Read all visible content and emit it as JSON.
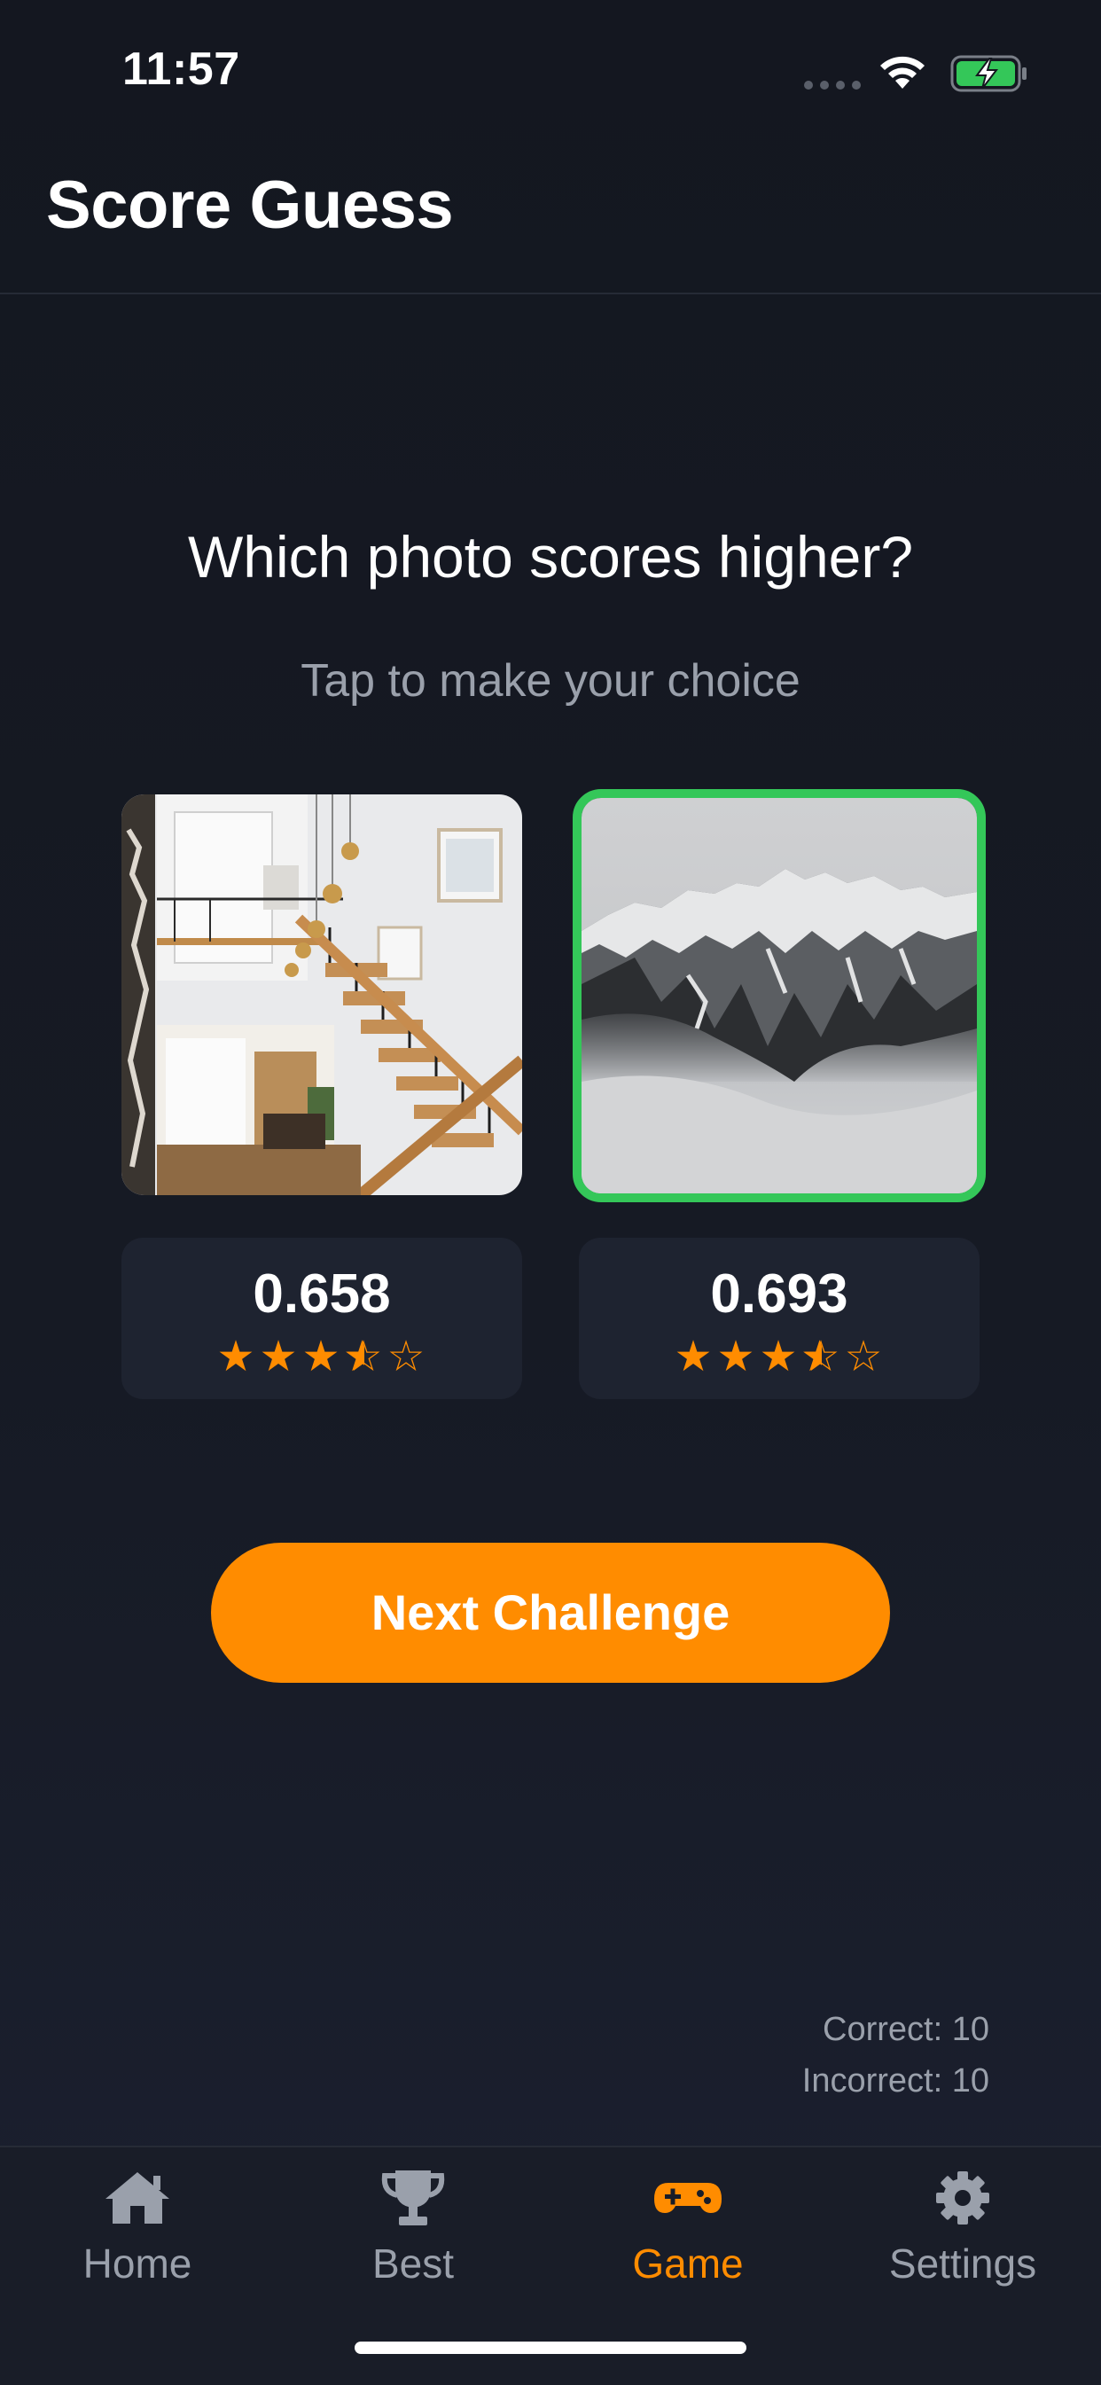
{
  "status_bar": {
    "time": "11:57",
    "icons": [
      "signal-dots-icon",
      "wifi-icon",
      "battery-charging-icon"
    ]
  },
  "nav": {
    "title": "Score Guess"
  },
  "prompt": {
    "question": "Which photo scores higher?",
    "subtitle": "Tap to make your choice"
  },
  "photos": [
    {
      "subject": "interior staircase with pendant lamps",
      "selected": false,
      "score": "0.658",
      "stars": 3.5,
      "max_stars": 5
    },
    {
      "subject": "snowy mountain peaks above clouds",
      "selected": true,
      "score": "0.693",
      "stars": 3.5,
      "max_stars": 5
    }
  ],
  "next_button": {
    "label": "Next Challenge"
  },
  "stats": {
    "correct": "Correct: 10",
    "incorrect": "Incorrect: 10"
  },
  "tab_bar": {
    "tabs": [
      {
        "label": "Home",
        "icon": "house-icon",
        "active": false
      },
      {
        "label": "Best",
        "icon": "trophy-icon",
        "active": false
      },
      {
        "label": "Game",
        "icon": "gamepad-icon",
        "active": true
      },
      {
        "label": "Settings",
        "icon": "gear-icon",
        "active": false
      }
    ]
  },
  "colors": {
    "accent": "#ff8c00",
    "selected_border": "#34c759",
    "background": "#14171f",
    "card": "#1e2330",
    "muted_text": "#9aa0ab"
  }
}
